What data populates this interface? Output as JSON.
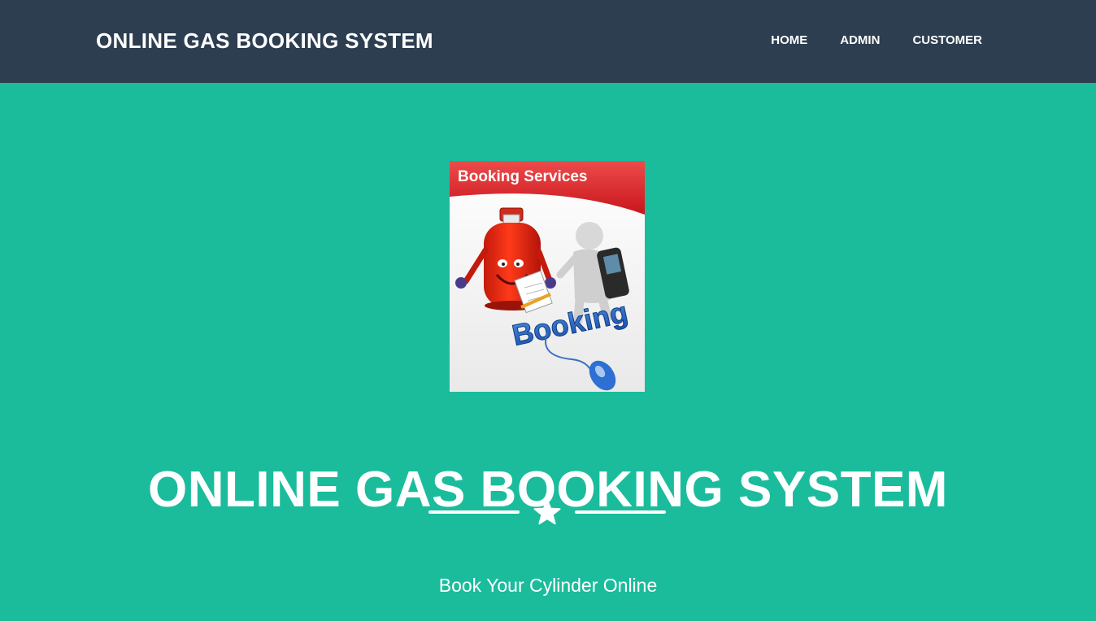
{
  "navbar": {
    "brand": "ONLINE GAS BOOKING SYSTEM",
    "links": [
      {
        "label": "HOME"
      },
      {
        "label": "ADMIN"
      },
      {
        "label": "CUSTOMER"
      }
    ],
    "background": "#2c3e50"
  },
  "masthead": {
    "image": {
      "caption": "Booking Services",
      "word": "Booking",
      "icons": [
        "gas-cylinder-icon",
        "person-with-phone-icon",
        "computer-mouse-icon",
        "clipboard-icon"
      ]
    },
    "title": "ONLINE GAS BOOKING SYSTEM",
    "divider_icon": "star-icon",
    "subtitle": "Book Your Cylinder Online",
    "background": "#1abc9c"
  }
}
